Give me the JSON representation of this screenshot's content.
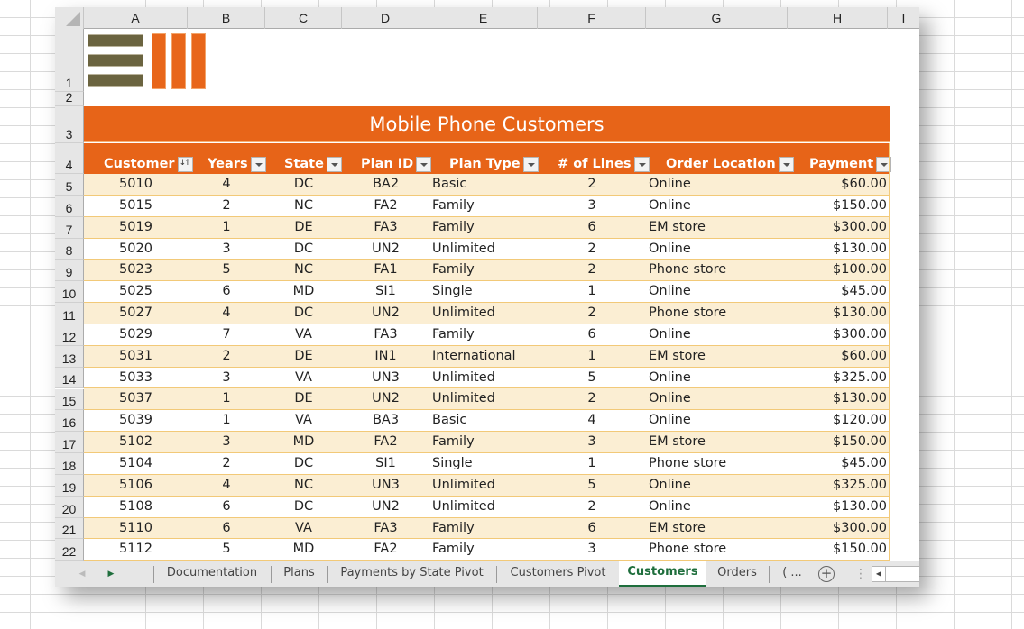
{
  "columns": [
    "A",
    "B",
    "C",
    "D",
    "E",
    "F",
    "G",
    "H",
    "I"
  ],
  "row_numbers": [
    "1",
    "2",
    "3",
    "4",
    "5",
    "6",
    "7",
    "8",
    "9",
    "10",
    "11",
    "12",
    "13",
    "14",
    "15",
    "16",
    "17",
    "18",
    "19",
    "20",
    "21",
    "22"
  ],
  "banner": {
    "title": "Mobile Phone Customers"
  },
  "colors": {
    "accent": "#e76418",
    "band": "#fbeed3",
    "logo_dark": "#6b6440",
    "active_tab": "#1e6e3c"
  },
  "table": {
    "headers": [
      {
        "label": "Customer",
        "filter": "sort-ascending-icon"
      },
      {
        "label": "Years",
        "filter": "filter-dropdown-icon"
      },
      {
        "label": "State",
        "filter": "filter-dropdown-icon"
      },
      {
        "label": "Plan ID",
        "filter": "filter-dropdown-icon"
      },
      {
        "label": "Plan Type",
        "filter": "filter-dropdown-icon"
      },
      {
        "label": "# of Lines",
        "filter": "filter-dropdown-icon"
      },
      {
        "label": "Order Location",
        "filter": "filter-dropdown-icon"
      },
      {
        "label": "Payment",
        "filter": "filter-dropdown-icon"
      }
    ],
    "rows": [
      [
        "5010",
        "4",
        "DC",
        "BA2",
        "Basic",
        "2",
        "Online",
        "$60.00"
      ],
      [
        "5015",
        "2",
        "NC",
        "FA2",
        "Family",
        "3",
        "Online",
        "$150.00"
      ],
      [
        "5019",
        "1",
        "DE",
        "FA3",
        "Family",
        "6",
        "EM store",
        "$300.00"
      ],
      [
        "5020",
        "3",
        "DC",
        "UN2",
        "Unlimited",
        "2",
        "Online",
        "$130.00"
      ],
      [
        "5023",
        "5",
        "NC",
        "FA1",
        "Family",
        "2",
        "Phone store",
        "$100.00"
      ],
      [
        "5025",
        "6",
        "MD",
        "SI1",
        "Single",
        "1",
        "Online",
        "$45.00"
      ],
      [
        "5027",
        "4",
        "DC",
        "UN2",
        "Unlimited",
        "2",
        "Phone store",
        "$130.00"
      ],
      [
        "5029",
        "7",
        "VA",
        "FA3",
        "Family",
        "6",
        "Online",
        "$300.00"
      ],
      [
        "5031",
        "2",
        "DE",
        "IN1",
        "International",
        "1",
        "EM store",
        "$60.00"
      ],
      [
        "5033",
        "3",
        "VA",
        "UN3",
        "Unlimited",
        "5",
        "Online",
        "$325.00"
      ],
      [
        "5037",
        "1",
        "DE",
        "UN2",
        "Unlimited",
        "2",
        "Online",
        "$130.00"
      ],
      [
        "5039",
        "1",
        "VA",
        "BA3",
        "Basic",
        "4",
        "Online",
        "$120.00"
      ],
      [
        "5102",
        "3",
        "MD",
        "FA2",
        "Family",
        "3",
        "EM store",
        "$150.00"
      ],
      [
        "5104",
        "2",
        "DC",
        "SI1",
        "Single",
        "1",
        "Phone store",
        "$45.00"
      ],
      [
        "5106",
        "4",
        "NC",
        "UN3",
        "Unlimited",
        "5",
        "Online",
        "$325.00"
      ],
      [
        "5108",
        "6",
        "DC",
        "UN2",
        "Unlimited",
        "2",
        "Online",
        "$130.00"
      ],
      [
        "5110",
        "6",
        "VA",
        "FA3",
        "Family",
        "6",
        "EM store",
        "$300.00"
      ],
      [
        "5112",
        "5",
        "MD",
        "FA2",
        "Family",
        "3",
        "Phone store",
        "$150.00"
      ]
    ]
  },
  "sheet_tabs": {
    "nav_prev": "◀",
    "nav_next": "▶",
    "tabs": [
      {
        "label": "Documentation",
        "active": false
      },
      {
        "label": "Plans",
        "active": false
      },
      {
        "label": "Payments by State Pivot",
        "active": false
      },
      {
        "label": "Customers Pivot",
        "active": false
      },
      {
        "label": "Customers",
        "active": true
      },
      {
        "label": "Orders",
        "active": false
      },
      {
        "label": "( ...",
        "active": false
      }
    ],
    "add_sheet": "+",
    "more": "⋮",
    "scroll_left": "◀"
  }
}
